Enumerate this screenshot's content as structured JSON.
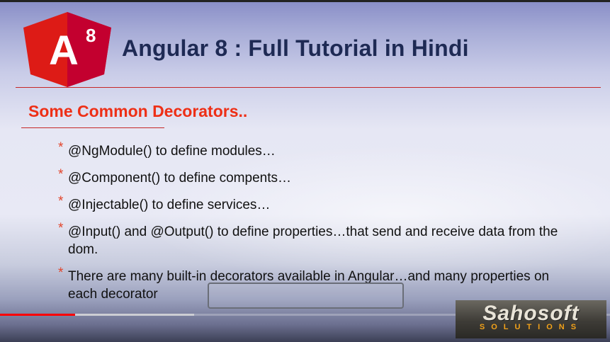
{
  "video": {
    "logo_text": "A",
    "logo_version": "8",
    "title": "Angular 8 : Full Tutorial in Hindi",
    "subtitle": "Some Common Decorators..",
    "bullets": [
      "@NgModule() to define modules…",
      "@Component() to define compents…",
      "@Injectable() to define services…",
      "@Input() and @Output() to define properties…that send and receive data from the dom.",
      "There are many built-in decorators available in Angular…and many properties on each decorator"
    ],
    "bullet_marker": "*",
    "brand_name": "Sahosoft",
    "brand_tagline": "SOLUTIONS"
  },
  "player": {
    "progress_played": 0.123,
    "progress_buffered": 0.318
  },
  "colors": {
    "accent": "#ee2f16",
    "title": "#1e2a54",
    "progress": "#ff0000",
    "logo_red": "#dd1b16",
    "logo_dark_red": "#c3002f"
  }
}
